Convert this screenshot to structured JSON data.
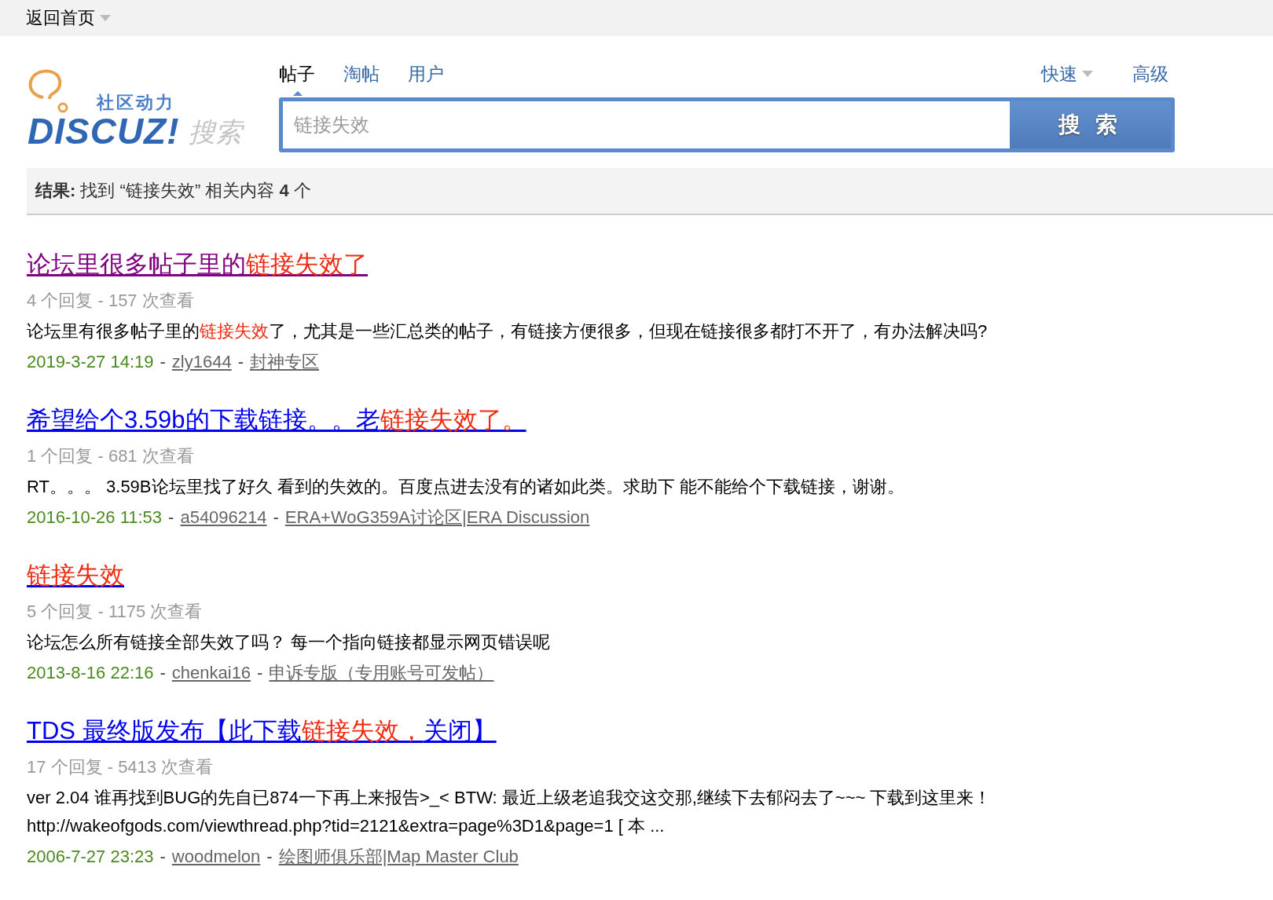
{
  "top_bar": {
    "home_link": "返回首页"
  },
  "logo": {
    "tagline": "社区动力",
    "wordmark": "DISCUZ!",
    "suffix": "搜索"
  },
  "search_tabs": [
    {
      "label": "帖子",
      "selected": true
    },
    {
      "label": "淘帖",
      "selected": false
    },
    {
      "label": "用户",
      "selected": false
    }
  ],
  "search_options": {
    "quick": "快速",
    "advanced": "高级"
  },
  "search": {
    "value": "链接失效",
    "button": "搜 索"
  },
  "meta_separator": "-",
  "summary": "**结果:** 找到 “链接失效” 相关内容 **4** 个",
  "results": [
    {
      "visited": true,
      "title": [
        {
          "text": "论坛里很多帖子里的",
          "highlight": false
        },
        {
          "text": "链接失效了",
          "highlight": true
        }
      ],
      "stats": "4 个回复 - 157 次查看",
      "snippet": [
        {
          "text": "论坛里有很多帖子里的",
          "highlight": false
        },
        {
          "text": "链接失效",
          "highlight": true
        },
        {
          "text": "了，尤其是一些汇总类的帖子，有链接方便很多，但现在链接很多都打不开了，有办法解决吗?",
          "highlight": false
        }
      ],
      "date": "2019-3-27 14:19",
      "author": "zly1644",
      "forum": "封神专区"
    },
    {
      "visited": false,
      "title": [
        {
          "text": "希望给个3.59b的下载链接。。老",
          "highlight": false
        },
        {
          "text": "链接失效了。",
          "highlight": true
        }
      ],
      "stats": "1 个回复 - 681 次查看",
      "snippet": [
        {
          "text": "RT。。。 3.59B论坛里找了好久 看到的失效的。百度点进去没有的诸如此类。求助下 能不能给个下载链接，谢谢。",
          "highlight": false
        }
      ],
      "date": "2016-10-26 11:53",
      "author": "a54096214",
      "forum": "ERA+WoG359A讨论区|ERA Discussion"
    },
    {
      "visited": false,
      "title": [
        {
          "text": "链接失效",
          "highlight": true
        }
      ],
      "stats": "5 个回复 - 1175 次查看",
      "snippet": [
        {
          "text": "论坛怎么所有链接全部失效了吗？ 每一个指向链接都显示网页错误呢",
          "highlight": false
        }
      ],
      "date": "2013-8-16 22:16",
      "author": "chenkai16",
      "forum": "申诉专版（专用账号可发帖）"
    },
    {
      "visited": false,
      "title": [
        {
          "text": "TDS 最终版发布【此下载",
          "highlight": false
        },
        {
          "text": "链接失效，",
          "highlight": true
        },
        {
          "text": "关闭】",
          "highlight": false
        }
      ],
      "stats": "17 个回复 - 5413 次查看",
      "snippet": [
        {
          "text": "ver 2.04 谁再找到BUG的先自已874一下再上来报告>_< BTW: 最近上级老追我交这交那,继续下去郁闷去了~~~ 下载到这里来！ http://wakeofgods.com/viewthread.php?tid=2121&extra=page%3D1&page=1 [ 本 ...",
          "highlight": false
        }
      ],
      "date": "2006-7-27 23:23",
      "author": "woodmelon",
      "forum": "绘图师俱乐部|Map Master Club"
    }
  ]
}
